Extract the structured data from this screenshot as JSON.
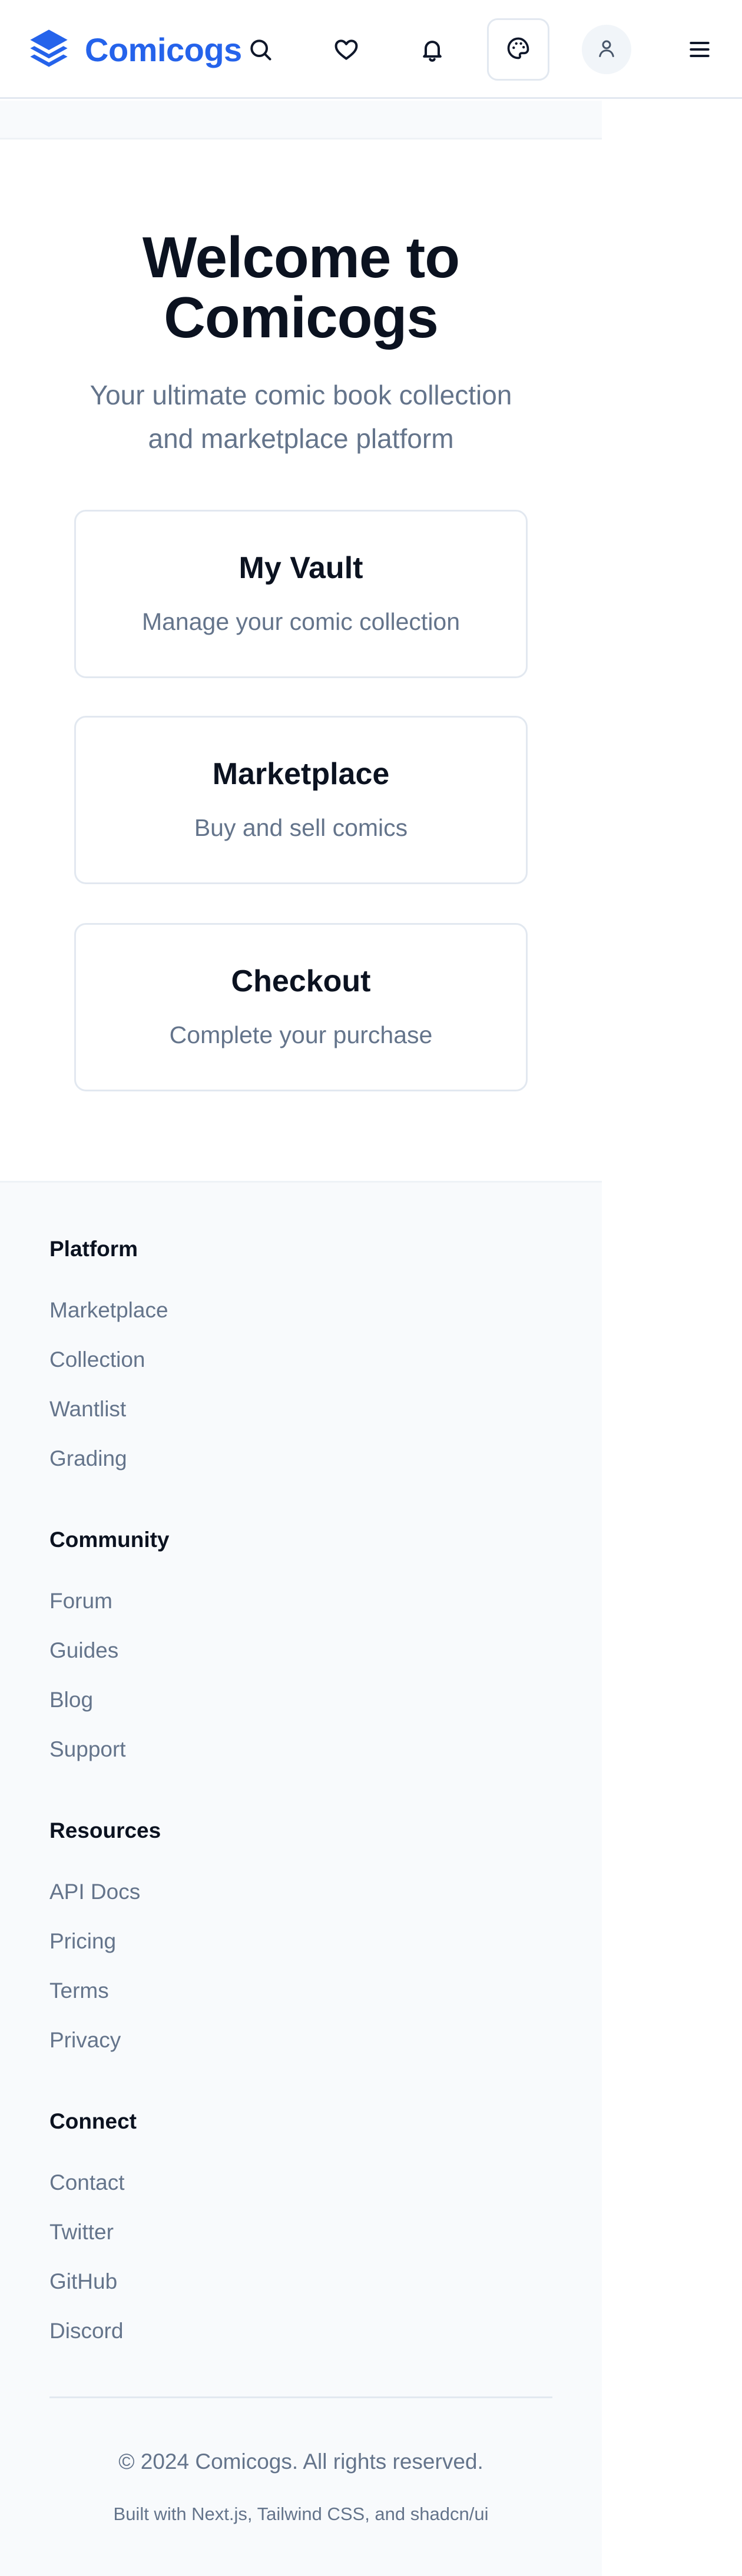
{
  "header": {
    "brand_name": "Comicogs",
    "icons": [
      "search-icon",
      "heart-icon",
      "bell-icon",
      "palette-icon",
      "user-icon",
      "menu-icon"
    ],
    "brand_color": "#2563eb"
  },
  "hero": {
    "title_line1": "Welcome to",
    "title_line2": "Comicogs",
    "subtitle_line1": "Your ultimate comic book collection",
    "subtitle_line2": "and marketplace platform"
  },
  "cards": [
    {
      "title": "My Vault",
      "description": "Manage your comic collection"
    },
    {
      "title": "Marketplace",
      "description": "Buy and sell comics"
    },
    {
      "title": "Checkout",
      "description": "Complete your purchase"
    }
  ],
  "footer": {
    "sections": [
      {
        "heading": "Platform",
        "links": [
          "Marketplace",
          "Collection",
          "Wantlist",
          "Grading"
        ]
      },
      {
        "heading": "Community",
        "links": [
          "Forum",
          "Guides",
          "Blog",
          "Support"
        ]
      },
      {
        "heading": "Resources",
        "links": [
          "API Docs",
          "Pricing",
          "Terms",
          "Privacy"
        ]
      },
      {
        "heading": "Connect",
        "links": [
          "Contact",
          "Twitter",
          "GitHub",
          "Discord"
        ]
      }
    ],
    "copyright": "© 2024 Comicogs. All rights reserved.",
    "built_with": "Built with Next.js, Tailwind CSS, and shadcn/ui"
  }
}
